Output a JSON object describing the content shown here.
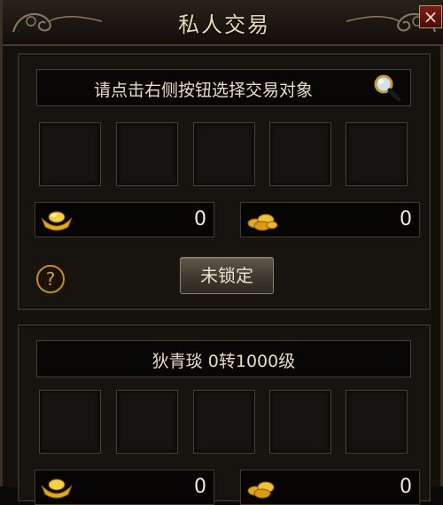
{
  "window": {
    "title": "私人交易",
    "close_label": "×"
  },
  "top_panel": {
    "prompt": "请点击右侧按钮选择交易对象",
    "ingot_amount": "0",
    "gold_amount": "0",
    "lock_label": "未锁定"
  },
  "bottom_panel": {
    "player_info": "狄青琰  0转1000级",
    "ingot_amount": "0",
    "gold_amount": "0"
  },
  "icons": {
    "search": "magnifier-icon",
    "ingot": "gold-ingot-icon",
    "coins": "gold-coins-icon",
    "help": "question-mark-icon"
  }
}
